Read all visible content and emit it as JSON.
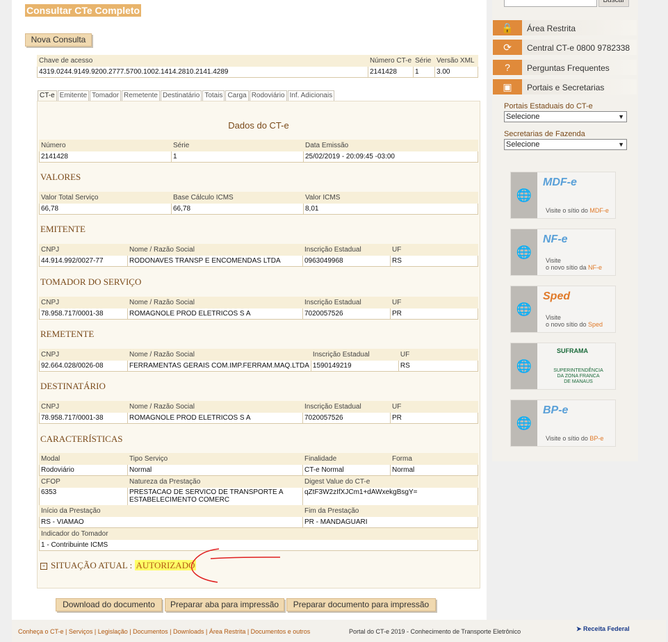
{
  "page_title": "Consultar CTe Completo",
  "nova_consulta": "Nova Consulta",
  "chave": {
    "headers": [
      "Chave de acesso",
      "Número CT-e",
      "Série",
      "Versão XML"
    ],
    "values": [
      "4319.0244.9149.9200.2777.5700.1002.1414.2810.2141.4289",
      "2141428",
      "1",
      "3.00"
    ]
  },
  "tabs": [
    "CT-e",
    "Emitente",
    "Tomador",
    "Remetente",
    "Destinatário",
    "Totais",
    "Carga",
    "Rodoviário",
    "Inf. Adicionais"
  ],
  "dados_title": "Dados do CT-e",
  "dados": {
    "headers": [
      "Número",
      "Série",
      "Data Emissão"
    ],
    "values": [
      "2141428",
      "1",
      "25/02/2019 - 20:09:45  -03:00"
    ]
  },
  "valores": {
    "title": "VALORES",
    "headers": [
      "Valor Total Serviço",
      "Base Cálculo ICMS",
      "Valor ICMS"
    ],
    "values": [
      "66,78",
      "66,78",
      "8,01"
    ]
  },
  "emitente": {
    "title": "EMITENTE",
    "headers": [
      "CNPJ",
      "Nome / Razão Social",
      "Inscrição Estadual",
      "UF"
    ],
    "values": [
      "44.914.992/0027-77",
      "RODONAVES TRANSP E ENCOMENDAS LTDA",
      "0963049968",
      "RS"
    ]
  },
  "tomador": {
    "title": "TOMADOR DO SERVIÇO",
    "headers": [
      "CNPJ",
      "Nome / Razão Social",
      "Inscrição Estadual",
      "UF"
    ],
    "values": [
      "78.958.717/0001-38",
      "ROMAGNOLE PROD ELETRICOS S A",
      "7020057526",
      "PR"
    ]
  },
  "remetente": {
    "title": "REMETENTE",
    "headers": [
      "CNPJ",
      "Nome / Razão Social",
      "Inscrição Estadual",
      "UF"
    ],
    "values": [
      "92.664.028/0026-08",
      "FERRAMENTAS GERAIS COM.IMP.FERRAM.MAQ.LTDA",
      "1590149219",
      "RS"
    ]
  },
  "destinatario": {
    "title": "DESTINATÁRIO",
    "headers": [
      "CNPJ",
      "Nome / Razão Social",
      "Inscrição Estadual",
      "UF"
    ],
    "values": [
      "78.958.717/0001-38",
      "ROMAGNOLE PROD ELETRICOS S A",
      "7020057526",
      "PR"
    ]
  },
  "caracteristicas": {
    "title": "CARACTERÍSTICAS",
    "row1_headers": [
      "Modal",
      "Tipo Serviço",
      "Finalidade",
      "Forma"
    ],
    "row1_values": [
      "Rodoviário",
      "Normal",
      "CT-e Normal",
      "Normal"
    ],
    "row2_headers": [
      "CFOP",
      "Natureza da Prestação",
      "Digest Value do CT-e"
    ],
    "row2_values": [
      "6353",
      "PRESTACAO DE SERVICO DE TRANSPORTE A",
      "ESTABELECIMENTO COMERC",
      "qZtF3W2zIfXJCm1+dAWxekgBsgY="
    ],
    "row3_headers": [
      "Início da Prestação",
      "Fim da Prestação"
    ],
    "row3_values": [
      "RS - VIAMAO",
      "PR - MANDAGUARI"
    ],
    "row4_header": "Indicador do Tomador",
    "row4_value": "1 - Contribuinte ICMS"
  },
  "situacao": {
    "label": "SITUAÇÃO ATUAL : ",
    "value": "AUTORIZADO"
  },
  "buttons": {
    "download": "Download do documento",
    "aba": "Preparar aba para impressão",
    "doc": "Preparar documento para impressão"
  },
  "sidebar": {
    "search_btn": "Buscar",
    "menu": [
      "Área Restrita",
      "Central CT-e 0800 9782338",
      "Perguntas Frequentes",
      "Portais e Secretarias"
    ],
    "portais_label": "Portais Estaduais do CT-e",
    "portais_value": "Selecione",
    "secretarias_label": "Secretarias de Fazenda",
    "secretarias_value": "Selecione",
    "banners": [
      {
        "logo": "MDF-e",
        "line1": "Visite o sítio do ",
        "hl": "MDF-e"
      },
      {
        "logo": "NF-e",
        "line1": "Visite",
        "line2": "o novo sítio da ",
        "hl": "NF-e"
      },
      {
        "logo": "Sped",
        "line1": "Visite",
        "line2": "o novo sítio do ",
        "hl": "Sped"
      },
      {
        "logo": "SUFRAMA",
        "line1": "SUPERINTENDÊNCIA",
        "line2": "DA ZONA FRANCA",
        "line3": "DE MANAUS"
      },
      {
        "logo": "BP-e",
        "line1": "Visite o sítio do ",
        "hl": "BP-e"
      }
    ]
  },
  "footer": {
    "links": "Conheça o CT-e | Serviços | Legislação | Documentos | Downloads | Área Restrita | Documentos e outros",
    "portal": "Portal do CT-e 2019 - Conhecimento de Transporte Eletrônico",
    "rf": "Receita Federal"
  },
  "colors": {
    "accent": "#e8b46c",
    "section": "#7a4a1a",
    "highlight": "#ffff66",
    "annotation": "#e02020"
  }
}
